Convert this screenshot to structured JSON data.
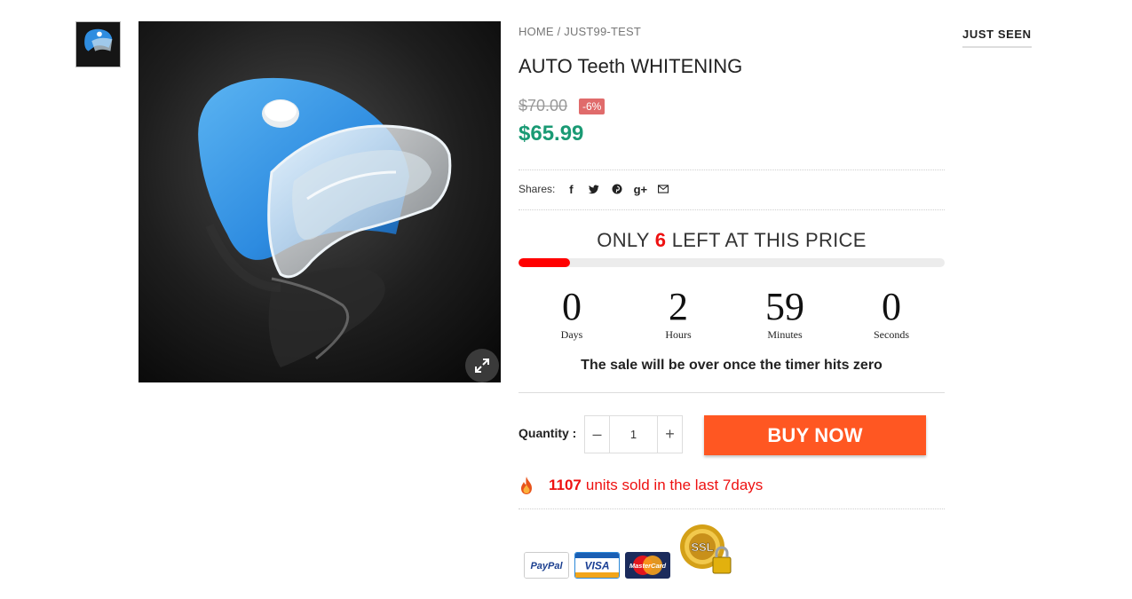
{
  "breadcrumb": {
    "home": "HOME",
    "separator": " / ",
    "current": "JUST99-TEST"
  },
  "product": {
    "title": "AUTO Teeth WHITENING",
    "old_price": "$70.00",
    "discount_badge": "-6%",
    "price": "$65.99",
    "image_alt_icon": "product-image"
  },
  "shares": {
    "label": "Shares:",
    "icons": [
      "facebook-icon",
      "twitter-icon",
      "pinterest-icon",
      "google-plus-icon",
      "email-icon"
    ],
    "glyphs": [
      "f",
      "t",
      "p",
      "g+",
      "✉"
    ]
  },
  "stock": {
    "prefix": "ONLY ",
    "count": "6",
    "suffix": " LEFT AT THIS PRICE",
    "fill_fraction": 0.12,
    "bar_color": "#ff0000"
  },
  "countdown": {
    "days": "0",
    "days_label": "Days",
    "hours": "2",
    "hours_label": "Hours",
    "minutes": "59",
    "minutes_label": "Minutes",
    "seconds": "0",
    "seconds_label": "Seconds",
    "note": "The sale will be over once the timer hits zero"
  },
  "purchase": {
    "quantity_label": "Quantity :",
    "quantity_value": "1",
    "minus": "–",
    "plus": "+",
    "buy_label": "BUY NOW",
    "buy_color": "#ff5722"
  },
  "sold": {
    "count": "1107",
    "text": "units sold in the last 7days",
    "icon": "fire-icon"
  },
  "payments": {
    "paypal": "PayPal",
    "visa": "VISA",
    "mastercard": "MasterCard",
    "ssl": "SSL"
  },
  "sidebar": {
    "just_seen": "JUST SEEN"
  },
  "colors": {
    "price": "#1a9a74",
    "accent_red": "#e11111",
    "discount_bg": "#e06b6b"
  }
}
